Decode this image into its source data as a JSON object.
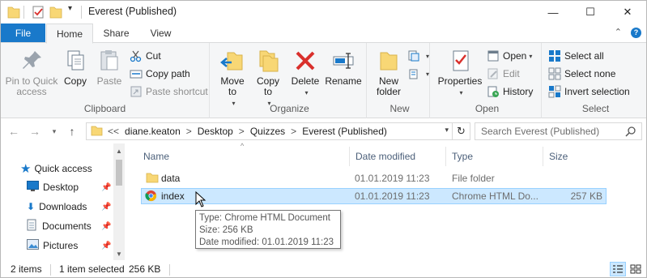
{
  "window": {
    "title": "Everest (Published)",
    "minimize_glyph": "—",
    "maximize_glyph": "☐",
    "close_glyph": "✕"
  },
  "tabs": [
    {
      "label": "File"
    },
    {
      "label": "Home"
    },
    {
      "label": "Share"
    },
    {
      "label": "View"
    }
  ],
  "ribbon": {
    "clipboard": {
      "label": "Clipboard",
      "pin_to_quick_access": "Pin to Quick access",
      "copy": "Copy",
      "paste": "Paste",
      "cut": "Cut",
      "copy_path": "Copy path",
      "paste_shortcut": "Paste shortcut"
    },
    "organize": {
      "label": "Organize",
      "move_to": "Move to",
      "copy_to": "Copy to",
      "delete": "Delete",
      "rename": "Rename"
    },
    "new": {
      "label": "New",
      "new_folder": "New folder"
    },
    "open": {
      "label": "Open",
      "properties": "Properties",
      "open": "Open",
      "edit": "Edit",
      "history": "History"
    },
    "select": {
      "label": "Select",
      "select_all": "Select all",
      "select_none": "Select none",
      "invert_selection": "Invert selection"
    }
  },
  "address": {
    "overflow": "<<",
    "crumbs": [
      "diane.keaton",
      "Desktop",
      "Quizzes",
      "Everest (Published)"
    ],
    "separator": ">",
    "search_placeholder": "Search Everest (Published)"
  },
  "nav": {
    "items": [
      {
        "label": "Quick access"
      },
      {
        "label": "Desktop"
      },
      {
        "label": "Downloads"
      },
      {
        "label": "Documents"
      },
      {
        "label": "Pictures"
      }
    ]
  },
  "columns": {
    "name": "Name",
    "date_modified": "Date modified",
    "type": "Type",
    "size": "Size"
  },
  "files": [
    {
      "name": "data",
      "date": "01.01.2019 11:23",
      "type": "File folder",
      "size": ""
    },
    {
      "name": "index",
      "date": "01.01.2019 11:23",
      "type": "Chrome HTML Do...",
      "size": "257 KB"
    }
  ],
  "tooltip": {
    "type": "Type: Chrome HTML Document",
    "size": "Size: 256 KB",
    "date": "Date modified: 01.01.2019 11:23"
  },
  "status": {
    "count": "2 items",
    "selected": "1 item selected",
    "selected_size": "256 KB"
  },
  "colors": {
    "accent": "#1979ca",
    "selection": "#cce8ff",
    "selection_border": "#99d1ff",
    "folder": "#f8d775",
    "delete_red": "#d9302c"
  }
}
